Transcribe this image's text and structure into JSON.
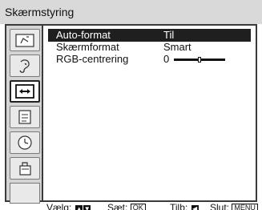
{
  "title": "Skærmstyring",
  "sidebar": {
    "items": [
      {
        "icon": "picture-icon",
        "active": false
      },
      {
        "icon": "sound-icon",
        "active": false
      },
      {
        "icon": "screen-control-icon",
        "active": true
      },
      {
        "icon": "features-icon",
        "active": false
      },
      {
        "icon": "timer-icon",
        "active": false
      },
      {
        "icon": "setup-icon",
        "active": false
      }
    ]
  },
  "menu": {
    "rows": [
      {
        "label": "Auto-format",
        "value": "Til"
      },
      {
        "label": "Skærmformat",
        "value": "Smart"
      },
      {
        "label": "RGB-centrering",
        "value": "0"
      }
    ],
    "rgb_slider_level": 0.5
  },
  "hints": {
    "select": "Vælg:",
    "set": "Sæt:",
    "set_key": "OK",
    "back": "Tilb:",
    "exit": "Slut:",
    "exit_key": "MENU"
  }
}
